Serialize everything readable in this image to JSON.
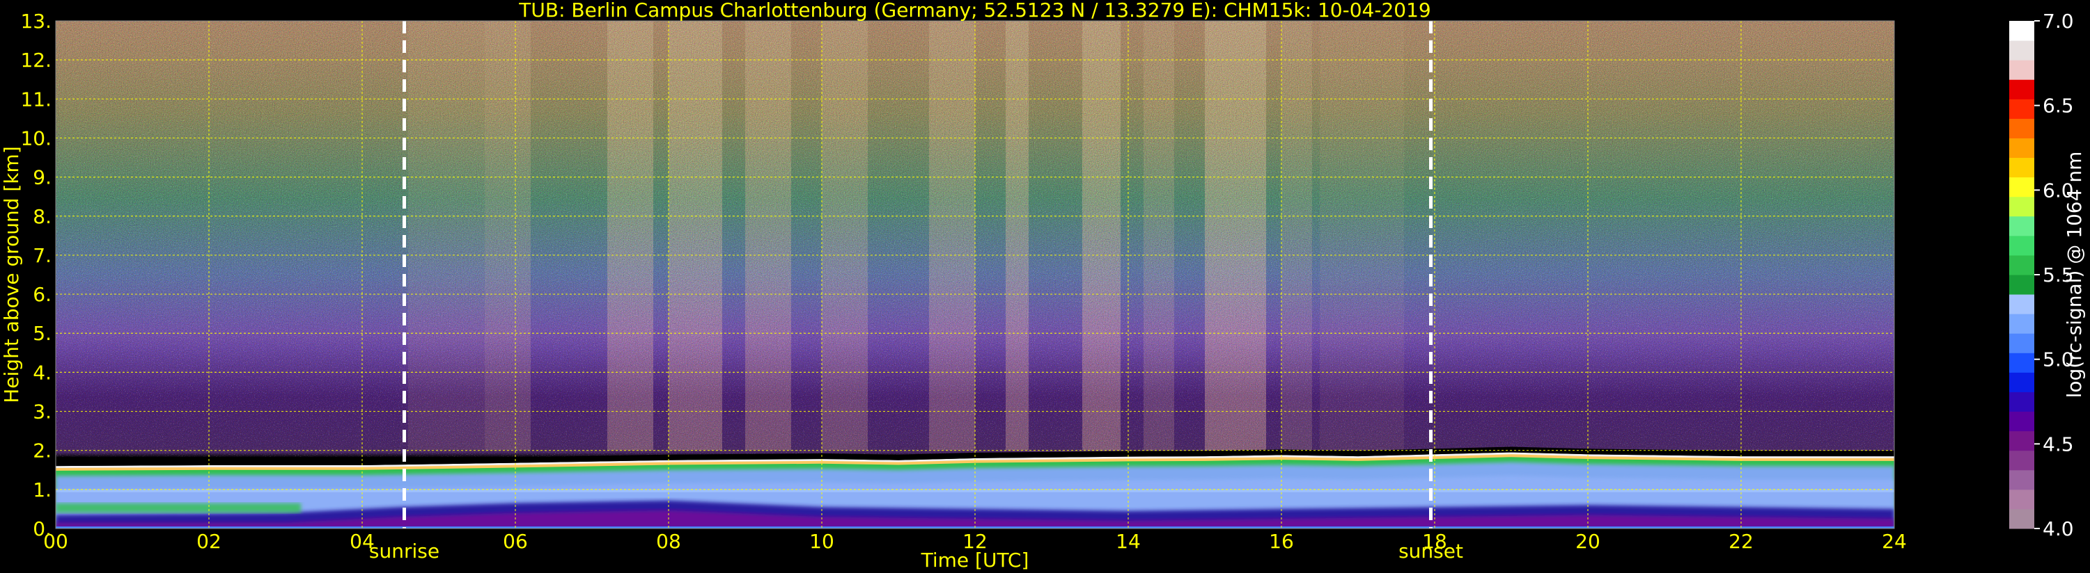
{
  "chart_data": {
    "type": "heatmap",
    "title": "TUB: Berlin Campus Charlottenburg (Germany; 52.5123 N / 13.3279 E):    CHM15k: 10-04-2019",
    "xlabel": "Time [UTC]",
    "ylabel": "Height above ground [km]",
    "xlim": [
      0,
      24
    ],
    "ylim": [
      0,
      13
    ],
    "x_ticks": [
      {
        "value": 0,
        "label": "00"
      },
      {
        "value": 2,
        "label": "02"
      },
      {
        "value": 4,
        "label": "04"
      },
      {
        "value": 6,
        "label": "06"
      },
      {
        "value": 8,
        "label": "08"
      },
      {
        "value": 10,
        "label": "10"
      },
      {
        "value": 12,
        "label": "12"
      },
      {
        "value": 14,
        "label": "14"
      },
      {
        "value": 16,
        "label": "16"
      },
      {
        "value": 18,
        "label": "18"
      },
      {
        "value": 20,
        "label": "20"
      },
      {
        "value": 22,
        "label": "22"
      },
      {
        "value": 24,
        "label": "24"
      }
    ],
    "y_ticks": [
      {
        "value": 0,
        "label": "0."
      },
      {
        "value": 1,
        "label": "1."
      },
      {
        "value": 2,
        "label": "2."
      },
      {
        "value": 3,
        "label": "3."
      },
      {
        "value": 4,
        "label": "4."
      },
      {
        "value": 5,
        "label": "5."
      },
      {
        "value": 6,
        "label": "6."
      },
      {
        "value": 7,
        "label": "7."
      },
      {
        "value": 8,
        "label": "8."
      },
      {
        "value": 9,
        "label": "9."
      },
      {
        "value": 10,
        "label": "10."
      },
      {
        "value": 11,
        "label": "11."
      },
      {
        "value": 12,
        "label": "12."
      },
      {
        "value": 13,
        "label": "13."
      }
    ],
    "grid": true,
    "annotations": [
      {
        "text": "sunrise",
        "x": 4.55
      },
      {
        "text": "sunset",
        "x": 17.95
      }
    ],
    "boundary_layer_top_km": [
      [
        0,
        1.6
      ],
      [
        2,
        1.62
      ],
      [
        4,
        1.62
      ],
      [
        6,
        1.68
      ],
      [
        8,
        1.75
      ],
      [
        10,
        1.78
      ],
      [
        11,
        1.75
      ],
      [
        12,
        1.8
      ],
      [
        13,
        1.82
      ],
      [
        14,
        1.84
      ],
      [
        15,
        1.85
      ],
      [
        16,
        1.88
      ],
      [
        17,
        1.85
      ],
      [
        18,
        1.9
      ],
      [
        19,
        1.95
      ],
      [
        20,
        1.9
      ],
      [
        22,
        1.85
      ],
      [
        24,
        1.85
      ]
    ],
    "colorbar": {
      "label": "log(rc-signal) @ 1064 nm",
      "range": [
        4.0,
        7.0
      ],
      "tick_labels": [
        "4.0",
        "4.5",
        "5.0",
        "5.5",
        "6.0",
        "6.5",
        "7.0"
      ],
      "tick_values": [
        4.0,
        4.5,
        5.0,
        5.5,
        6.0,
        6.5,
        7.0
      ],
      "colors": [
        "#a88ba0",
        "#b07ea6",
        "#9a62a0",
        "#86388f",
        "#76168a",
        "#5a00a0",
        "#2f08b8",
        "#0a1ee6",
        "#1a50ff",
        "#4f86ff",
        "#7aa8ff",
        "#a6c4ff",
        "#18a038",
        "#2ebf4c",
        "#3fdc6a",
        "#66ee8c",
        "#c6ff40",
        "#ffff20",
        "#ffd000",
        "#ffa000",
        "#ff6a00",
        "#ff2a00",
        "#e80000",
        "#f0c8c8",
        "#e8e0e0",
        "#ffffff"
      ]
    },
    "colors": {
      "background": "#000000",
      "text": "#ffff00",
      "grid": "#ffff00",
      "marker_lines": "#ffffff"
    }
  }
}
